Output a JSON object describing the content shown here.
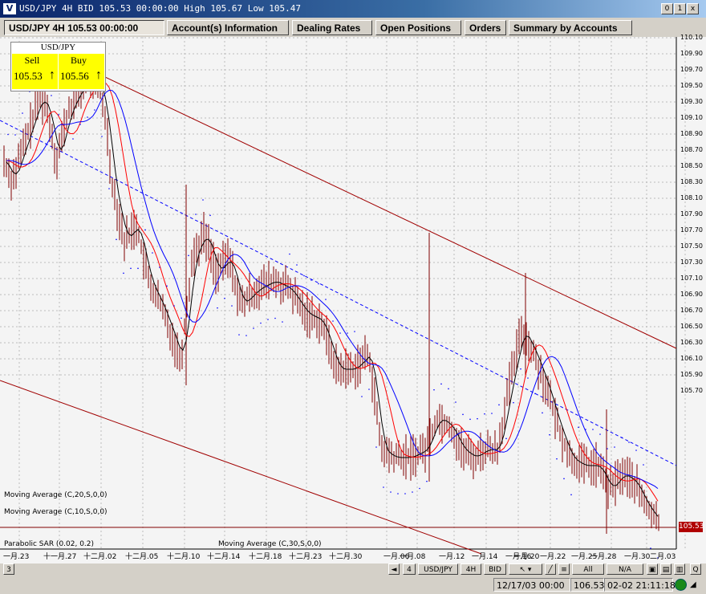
{
  "window": {
    "title": "USD/JPY 4H BID 105.53 00:00:00 High 105.67 Low 105.47",
    "logo": "V",
    "buttons": [
      "0",
      "1",
      "x"
    ]
  },
  "tabs": [
    {
      "label": "USD/JPY 4H 105.53 00:00:00",
      "active": true
    },
    {
      "label": "Account(s) Information",
      "active": false
    },
    {
      "label": "Dealing Rates",
      "active": false
    },
    {
      "label": "Open Positions",
      "active": false
    },
    {
      "label": "Orders",
      "active": false
    },
    {
      "label": "Summary by Accounts",
      "active": false
    }
  ],
  "quote": {
    "symbol": "USD/JPY",
    "sell_label": "Sell",
    "sell_value": "105.53",
    "buy_label": "Buy",
    "buy_value": "105.56",
    "arrow": "↑",
    "color": "#ffff00"
  },
  "chart_data": {
    "type": "line",
    "y_ticks": [
      "110.10",
      "109.90",
      "109.70",
      "109.50",
      "109.30",
      "109.10",
      "108.90",
      "108.70",
      "108.50",
      "108.30",
      "108.10",
      "107.90",
      "107.70",
      "107.50",
      "107.30",
      "107.10",
      "106.90",
      "106.70",
      "106.50",
      "106.30",
      "106.10",
      "105.90",
      "105.70",
      "105.53"
    ],
    "x_ticks": [
      "一月.23",
      "十一月.27",
      "十二月.02",
      "十二月.05",
      "十二月.10",
      "十二月.14",
      "十二月.18",
      "十二月.23",
      "十二月.30",
      "一月.06",
      "一月.08",
      "一月.12",
      "一月.14",
      "一月.16",
      "一月.20",
      "一月.22",
      "一月.25",
      "一月.28",
      "一月.30",
      "二月.03"
    ],
    "current_price": "105.53",
    "indicators": [
      "Moving Average (C,20,S,0,0)",
      "Moving Average (C,10,S,0,0)",
      "Parabolic SAR (0.02, 0.2)",
      "Moving Average (C,30,S,0,0)"
    ],
    "colors": {
      "candles": "#800000",
      "ma10": "#ff0000",
      "ma20": "#0000ff",
      "ma30": "#000000",
      "channel": "#a00000",
      "trend": "#0000ff",
      "sar": "#0000ff"
    },
    "grid": true
  },
  "status": {
    "left_number": "3",
    "page_number": "4",
    "symbol_button": "USD/JPY",
    "period_button": "4H",
    "side_button": "BID",
    "all_button": "All",
    "na_button": "N/A",
    "cursor_time": "12/17/03 00:00",
    "cursor_price": "106.53",
    "clock": "02-02 21:11:18",
    "zoom_label": "Q"
  }
}
